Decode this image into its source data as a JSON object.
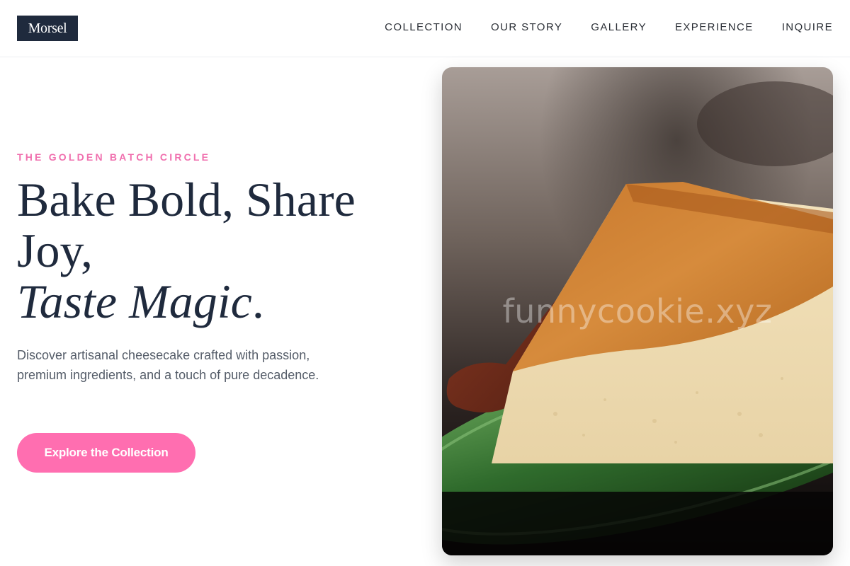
{
  "brand": {
    "logo_text": "Morsel"
  },
  "nav": {
    "items": [
      {
        "label": "COLLECTION"
      },
      {
        "label": "OUR STORY"
      },
      {
        "label": "GALLERY"
      },
      {
        "label": "EXPERIENCE"
      },
      {
        "label": "INQUIRE"
      }
    ]
  },
  "hero": {
    "eyebrow": "THE GOLDEN BATCH CIRCLE",
    "headline_line1": "Bake Bold, Share",
    "headline_line2": "Joy,",
    "headline_italic": "Taste Magic",
    "headline_period": ".",
    "subtitle": "Discover artisanal cheesecake crafted with passion, premium ingredients, and a touch of pure decadence.",
    "cta_label": "Explore the Collection",
    "image_watermark": "funnycookie.xyz"
  },
  "colors": {
    "accent": "#ff6eb0",
    "eyebrow": "#f06fae",
    "navy": "#1f2a3d",
    "text_muted": "#555d69"
  }
}
